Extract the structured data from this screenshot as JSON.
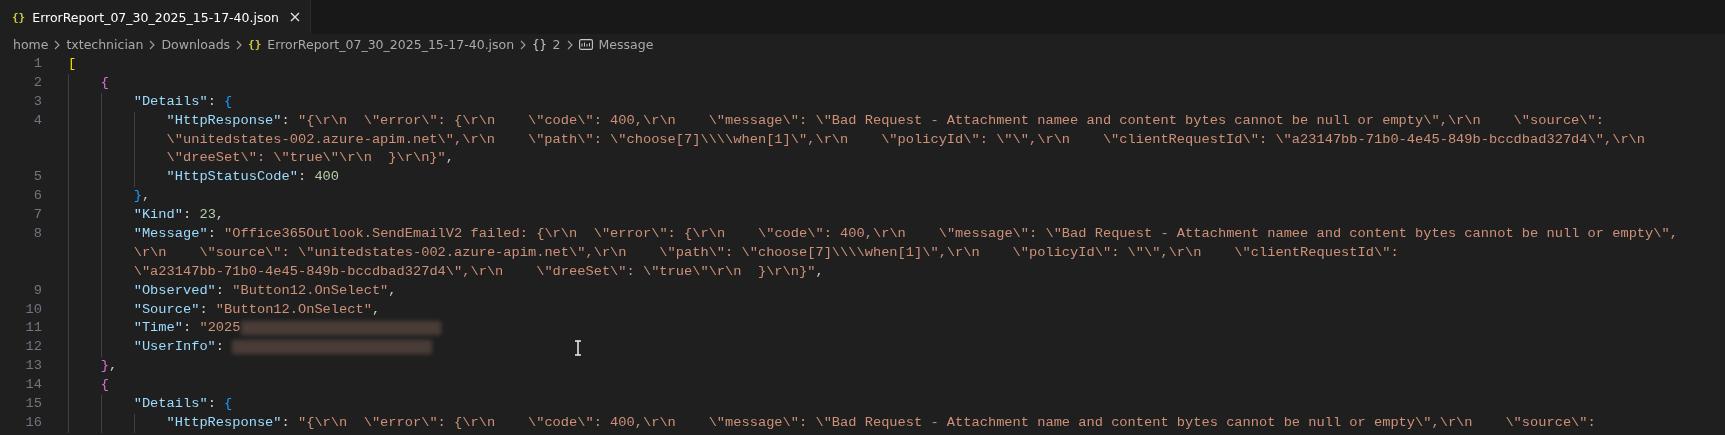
{
  "tab": {
    "icon": "{}",
    "title": "ErrorReport_07_30_2025_15-17-40.json",
    "selected": true
  },
  "breadcrumbs": [
    {
      "kind": "folder",
      "text": "home"
    },
    {
      "kind": "folder",
      "text": "txtechnician"
    },
    {
      "kind": "folder",
      "text": "Downloads"
    },
    {
      "kind": "file",
      "icon": "{}",
      "text": "ErrorReport_07_30_2025_15-17-40.json"
    },
    {
      "kind": "object",
      "icon": "{}",
      "text": "2"
    },
    {
      "kind": "string",
      "text": "Message"
    }
  ],
  "lines": [
    {
      "number": "1",
      "wrapped_lines": [
        {
          "tokens": [
            {
              "kind": "bracket1",
              "text": "["
            }
          ]
        }
      ],
      "children": [
        {
          "number": "2",
          "wrapped_lines": [
            {
              "tokens": [
                {
                  "kind": "bracket2",
                  "text": "{"
                }
              ]
            }
          ],
          "children": [
            {
              "number": "3",
              "wrapped_lines": [
                {
                  "tokens": [
                    {
                      "kind": "key",
                      "text": "\"Details\""
                    },
                    {
                      "kind": "punct",
                      "text": ": "
                    },
                    {
                      "kind": "bracket3",
                      "text": "{"
                    }
                  ]
                }
              ],
              "children": [
                {
                  "number": "4",
                  "wrapped_lines": [
                    {
                      "tokens": [
                        {
                          "kind": "key",
                          "text": "\"HttpResponse\""
                        },
                        {
                          "kind": "punct",
                          "text": ": "
                        },
                        {
                          "kind": "string",
                          "text": "\"{\\r\\n  \\\"error\\\": {\\r\\n    \\\"code\\\": 400,\\r\\n    \\\"message\\\": \\\"Bad Request - Attachment namee and content bytes cannot be null or empty\\\",\\r\\n    \\\"source\\\":"
                        }
                      ]
                    },
                    {
                      "tokens": [
                        {
                          "kind": "string",
                          "text": "\\\"unitedstates-002.azure-apim.net\\\",\\r\\n    \\\"path\\\": \\\"choose[7]\\\\\\\\when[1]\\\",\\r\\n    \\\"policyId\\\": \\\"\\\",\\r\\n    \\\"clientRequestId\\\": \\\"a23147bb-71b0-4e45-849b-bccdbad327d4\\\",\\r\\n"
                        }
                      ]
                    },
                    {
                      "tokens": [
                        {
                          "kind": "string",
                          "text": "\\\"dreeSet\\\": \\\"true\\\"\\r\\n  }\\r\\n}\""
                        },
                        {
                          "kind": "punct",
                          "text": ","
                        }
                      ]
                    }
                  ]
                },
                {
                  "number": "5",
                  "wrapped_lines": [
                    {
                      "tokens": [
                        {
                          "kind": "key",
                          "text": "\"HttpStatusCode\""
                        },
                        {
                          "kind": "punct",
                          "text": ": "
                        },
                        {
                          "kind": "number",
                          "text": "400"
                        }
                      ]
                    }
                  ]
                }
              ]
            },
            {
              "number": "6",
              "wrapped_lines": [
                {
                  "tokens": [
                    {
                      "kind": "bracket3",
                      "text": "}"
                    },
                    {
                      "kind": "punct",
                      "text": ","
                    }
                  ]
                }
              ]
            },
            {
              "number": "7",
              "wrapped_lines": [
                {
                  "tokens": [
                    {
                      "kind": "key",
                      "text": "\"Kind\""
                    },
                    {
                      "kind": "punct",
                      "text": ": "
                    },
                    {
                      "kind": "number",
                      "text": "23"
                    },
                    {
                      "kind": "punct",
                      "text": ","
                    }
                  ]
                }
              ]
            },
            {
              "number": "8",
              "wrapped_lines": [
                {
                  "tokens": [
                    {
                      "kind": "key",
                      "text": "\"Message\""
                    },
                    {
                      "kind": "punct",
                      "text": ": "
                    },
                    {
                      "kind": "string",
                      "text": "\"Office365Outlook.SendEmailV2 failed: {\\r\\n  \\\"error\\\": {\\r\\n    \\\"code\\\": 400,\\r\\n    \\\"message\\\": \\\"Bad Request - Attachment namee and content bytes cannot be null or empty\\\","
                    }
                  ]
                },
                {
                  "tokens": [
                    {
                      "kind": "string",
                      "text": "\\r\\n    \\\"source\\\": \\\"unitedstates-002.azure-apim.net\\\",\\r\\n    \\\"path\\\": \\\"choose[7]\\\\\\\\when[1]\\\",\\r\\n    \\\"policyId\\\": \\\"\\\",\\r\\n    \\\"clientRequestId\\\":"
                    }
                  ]
                },
                {
                  "tokens": [
                    {
                      "kind": "string",
                      "text": "\\\"a23147bb-71b0-4e45-849b-bccdbad327d4\\\",\\r\\n    \\\"dreeSet\\\": \\\"true\\\"\\r\\n  }\\r\\n}\""
                    },
                    {
                      "kind": "punct",
                      "text": ","
                    }
                  ]
                }
              ]
            },
            {
              "number": "9",
              "wrapped_lines": [
                {
                  "tokens": [
                    {
                      "kind": "key",
                      "text": "\"Observed\""
                    },
                    {
                      "kind": "punct",
                      "text": ": "
                    },
                    {
                      "kind": "string",
                      "text": "\"Button12.OnSelect\""
                    },
                    {
                      "kind": "punct",
                      "text": ","
                    }
                  ]
                }
              ]
            },
            {
              "number": "10",
              "wrapped_lines": [
                {
                  "tokens": [
                    {
                      "kind": "key",
                      "text": "\"Source\""
                    },
                    {
                      "kind": "punct",
                      "text": ": "
                    },
                    {
                      "kind": "string",
                      "text": "\"Button12.OnSelect\""
                    },
                    {
                      "kind": "punct",
                      "text": ","
                    }
                  ]
                }
              ]
            },
            {
              "number": "11",
              "wrapped_lines": [
                {
                  "tokens": [
                    {
                      "kind": "key",
                      "text": "\"Time\""
                    },
                    {
                      "kind": "punct",
                      "text": ": "
                    },
                    {
                      "kind": "string",
                      "text": "\"2025"
                    },
                    {
                      "kind": "redacted"
                    }
                  ]
                }
              ]
            },
            {
              "number": "12",
              "wrapped_lines": [
                {
                  "tokens": [
                    {
                      "kind": "key",
                      "text": "\"UserInfo\""
                    },
                    {
                      "kind": "punct",
                      "text": ": "
                    },
                    {
                      "kind": "redacted"
                    }
                  ]
                }
              ]
            }
          ]
        },
        {
          "number": "13",
          "wrapped_lines": [
            {
              "tokens": [
                {
                  "kind": "bracket2",
                  "text": "}"
                },
                {
                  "kind": "punct",
                  "text": ","
                }
              ]
            }
          ]
        },
        {
          "number": "14",
          "wrapped_lines": [
            {
              "tokens": [
                {
                  "kind": "bracket2",
                  "text": "{"
                }
              ]
            }
          ],
          "children": [
            {
              "number": "15",
              "wrapped_lines": [
                {
                  "tokens": [
                    {
                      "kind": "key",
                      "text": "\"Details\""
                    },
                    {
                      "kind": "punct",
                      "text": ": "
                    },
                    {
                      "kind": "bracket3",
                      "text": "{"
                    }
                  ]
                }
              ],
              "children": [
                {
                  "number": "16",
                  "wrapped_lines": [
                    {
                      "tokens": [
                        {
                          "kind": "key",
                          "text": "\"HttpResponse\""
                        },
                        {
                          "kind": "punct",
                          "text": ": "
                        },
                        {
                          "kind": "string",
                          "text": "\"{\\r\\n  \\\"error\\\": {\\r\\n    \\\"code\\\": 400,\\r\\n    \\\"message\\\": \\\"Bad Request - Attachment name and content bytes cannot be null or empty\\\",\\r\\n    \\\"source\\\":"
                        }
                      ]
                    }
                  ]
                }
              ]
            }
          ]
        }
      ]
    }
  ]
}
